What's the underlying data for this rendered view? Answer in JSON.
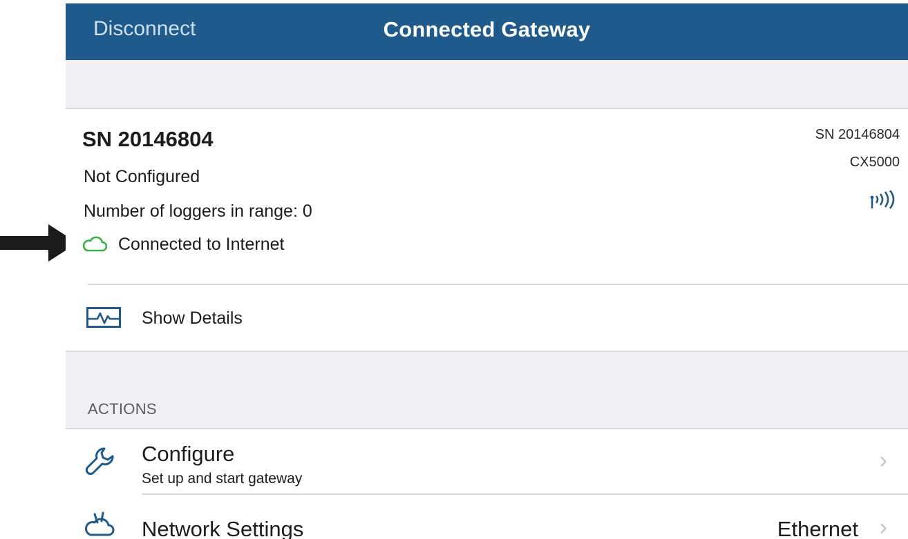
{
  "navbar": {
    "left_button": "Disconnect",
    "title": "Connected Gateway",
    "background": "#1e5a8c"
  },
  "gateway": {
    "title": "SN 20146804",
    "status": "Not Configured",
    "loggers_in_range": "Number of loggers in range: 0",
    "internet_status": "Connected to Internet",
    "internet_status_color": "#3cb043",
    "serial_right": "SN 20146804",
    "model": "CX5000",
    "icons": [
      "cloud-icon",
      "signal-icon"
    ]
  },
  "details": {
    "label": "Show Details",
    "icon": "pulse-monitor-icon"
  },
  "actions": {
    "header": "ACTIONS",
    "items": [
      {
        "title": "Configure",
        "subtitle": "Set up and start gateway",
        "icon": "wrench-icon",
        "chevron": "›"
      },
      {
        "title": "Network Settings",
        "value": "Ethernet",
        "icon": "cloud-network-icon",
        "chevron": "›"
      }
    ]
  },
  "annotation": {
    "icon": "arrow-right-icon",
    "color": "#1a1a1a"
  }
}
